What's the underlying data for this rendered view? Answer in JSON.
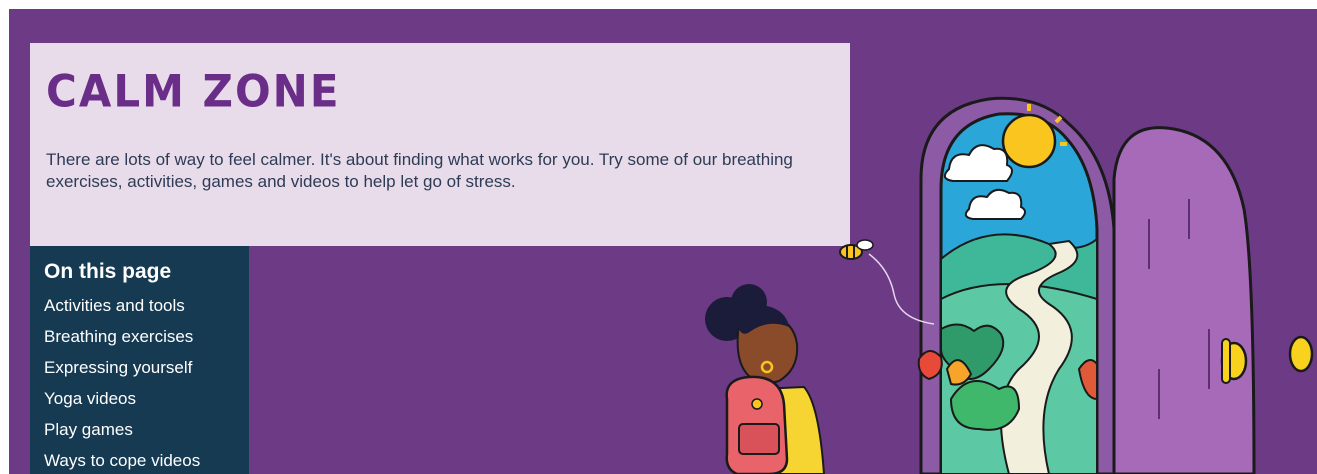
{
  "header": {
    "title": "CALM ZONE",
    "intro": "There are lots of way to feel calmer. It's about finding what works for you. Try some of our breathing exercises, activities, games and videos to help let go of stress."
  },
  "toc": {
    "heading": "On this page",
    "links": [
      "Activities and tools",
      "Breathing exercises",
      "Expressing yourself",
      "Yoga videos",
      "Play games",
      "Ways to cope videos"
    ]
  },
  "colors": {
    "hero_bg": "#6d3a86",
    "card_bg": "#e8dcea",
    "title": "#6a2e88",
    "toc_bg": "#153a52"
  },
  "illustration": {
    "icons": [
      "girl-illustration",
      "bee-icon",
      "door-illustration",
      "landscape-illustration",
      "sun-icon",
      "cloud-icon"
    ]
  }
}
